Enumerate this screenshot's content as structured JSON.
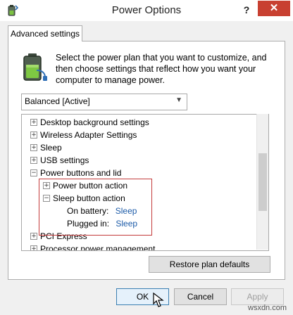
{
  "window": {
    "title": "Power Options",
    "help_label": "?",
    "close_label": "✕"
  },
  "tab": {
    "label": "Advanced settings"
  },
  "intro_text": "Select the power plan that you want to customize, and then choose settings that reflect how you want your computer to manage power.",
  "plan_select": {
    "value": "Balanced [Active]"
  },
  "tree": {
    "items": [
      {
        "label": "Desktop background settings",
        "expander": "+"
      },
      {
        "label": "Wireless Adapter Settings",
        "expander": "+"
      },
      {
        "label": "Sleep",
        "expander": "+"
      },
      {
        "label": "USB settings",
        "expander": "+"
      },
      {
        "label": "Power buttons and lid",
        "expander": "−"
      },
      {
        "label": "Power button action",
        "expander": "+"
      },
      {
        "label": "Sleep button action",
        "expander": "−"
      },
      {
        "label": "On battery:",
        "value": "Sleep"
      },
      {
        "label": "Plugged in:",
        "value": "Sleep"
      },
      {
        "label": "PCI Express",
        "expander": "+"
      },
      {
        "label": "Processor power management",
        "expander": "+"
      }
    ]
  },
  "buttons": {
    "restore": "Restore plan defaults",
    "ok": "OK",
    "cancel": "Cancel",
    "apply": "Apply"
  },
  "watermark": "wsxdn.com",
  "colors": {
    "close_bg": "#c84031",
    "link": "#1c5ba8",
    "highlight_border": "#c43b3b"
  }
}
